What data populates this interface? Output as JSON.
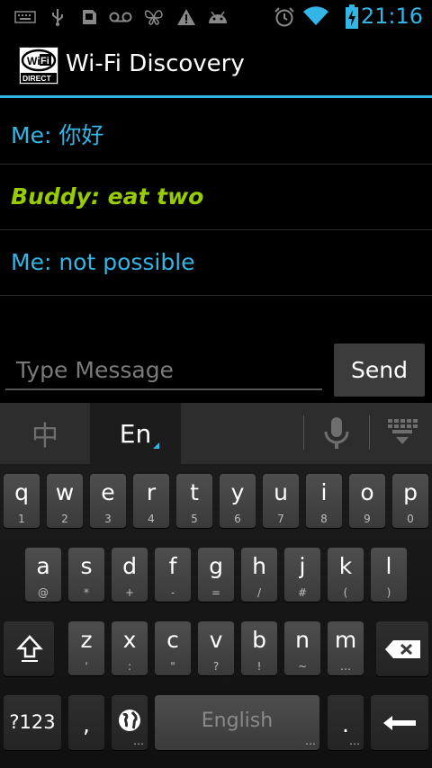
{
  "status_bar": {
    "time": "21:16",
    "icons": [
      "keyboard-icon",
      "usb-icon",
      "sd-card-icon",
      "voicemail-icon",
      "butterfly-icon",
      "warning-icon",
      "android-icon",
      "alarm-icon",
      "wifi-icon",
      "battery-charging-icon"
    ],
    "accent_color": "#33b5e5"
  },
  "action_bar": {
    "title": "Wi-Fi Discovery",
    "logo_text_top": "Wi",
    "logo_text_fi": "Fi",
    "logo_text_bottom": "DIRECT"
  },
  "messages": [
    {
      "text": "Me: 你好",
      "sender": "me",
      "color": "#33b5e5"
    },
    {
      "text": "Buddy: eat two",
      "sender": "buddy",
      "color": "#99cc00"
    },
    {
      "text": "Me: not possible",
      "sender": "me",
      "color": "#33b5e5"
    }
  ],
  "composer": {
    "placeholder": "Type Message",
    "send_label": "Send"
  },
  "keyboard": {
    "lang_zh": "中",
    "lang_en": "En",
    "row1": [
      {
        "k": "q",
        "s": "1"
      },
      {
        "k": "w",
        "s": "2"
      },
      {
        "k": "e",
        "s": "3"
      },
      {
        "k": "r",
        "s": "4"
      },
      {
        "k": "t",
        "s": "5"
      },
      {
        "k": "y",
        "s": "6"
      },
      {
        "k": "u",
        "s": "7"
      },
      {
        "k": "i",
        "s": "8"
      },
      {
        "k": "o",
        "s": "9"
      },
      {
        "k": "p",
        "s": "0"
      }
    ],
    "row2": [
      {
        "k": "a",
        "s": "@"
      },
      {
        "k": "s",
        "s": "*"
      },
      {
        "k": "d",
        "s": "+"
      },
      {
        "k": "f",
        "s": "-"
      },
      {
        "k": "g",
        "s": "="
      },
      {
        "k": "h",
        "s": "/"
      },
      {
        "k": "j",
        "s": "#"
      },
      {
        "k": "k",
        "s": "("
      },
      {
        "k": "l",
        "s": ")"
      }
    ],
    "row3": [
      {
        "k": "z",
        "s": "'"
      },
      {
        "k": "x",
        "s": ":"
      },
      {
        "k": "c",
        "s": "\""
      },
      {
        "k": "v",
        "s": "?"
      },
      {
        "k": "b",
        "s": "!"
      },
      {
        "k": "n",
        "s": "~"
      },
      {
        "k": "m",
        "s": "…"
      }
    ],
    "symbols_label": "?123",
    "comma": ",",
    "space_label": "English",
    "period": ".",
    "period_sub": "…",
    "globe_sub": "…"
  }
}
